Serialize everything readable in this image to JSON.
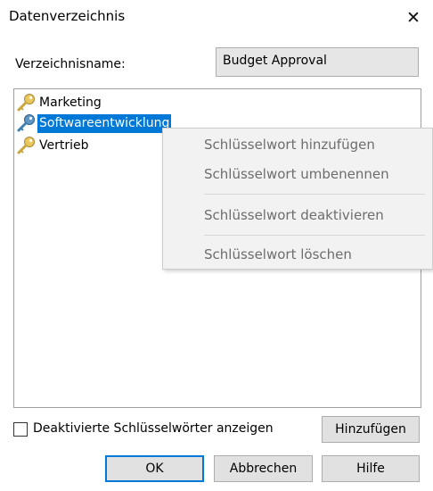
{
  "window": {
    "title": "Datenverzeichnis"
  },
  "directory": {
    "label": "Verzeichnisname:",
    "value": "Budget Approval"
  },
  "tree": {
    "items": [
      {
        "label": "Marketing",
        "icon": "key-icon-gold",
        "selected": false
      },
      {
        "label": "Softwareentwicklung",
        "icon": "key-icon-blue",
        "selected": true
      },
      {
        "label": "Vertrieb",
        "icon": "key-icon-gold",
        "selected": false
      }
    ]
  },
  "context_menu": {
    "items": [
      {
        "label": "Schlüsselwort hinzufügen",
        "enabled": false
      },
      {
        "label": "Schlüsselwort umbenennen",
        "enabled": false
      },
      {
        "label": "Schlüsselwort deaktivieren",
        "enabled": false
      },
      {
        "label": "Schlüsselwort löschen",
        "enabled": false
      }
    ]
  },
  "show_disabled": {
    "label": "Deaktivierte Schlüsselwörter anzeigen",
    "checked": false
  },
  "buttons": {
    "add": "Hinzufügen",
    "ok": "OK",
    "cancel": "Abbrechen",
    "help": "Hilfe"
  },
  "colors": {
    "selection": "#0078d7",
    "key_gold": "#e8c760",
    "key_blue": "#3f7fb0",
    "button_face": "#e1e1e1"
  }
}
